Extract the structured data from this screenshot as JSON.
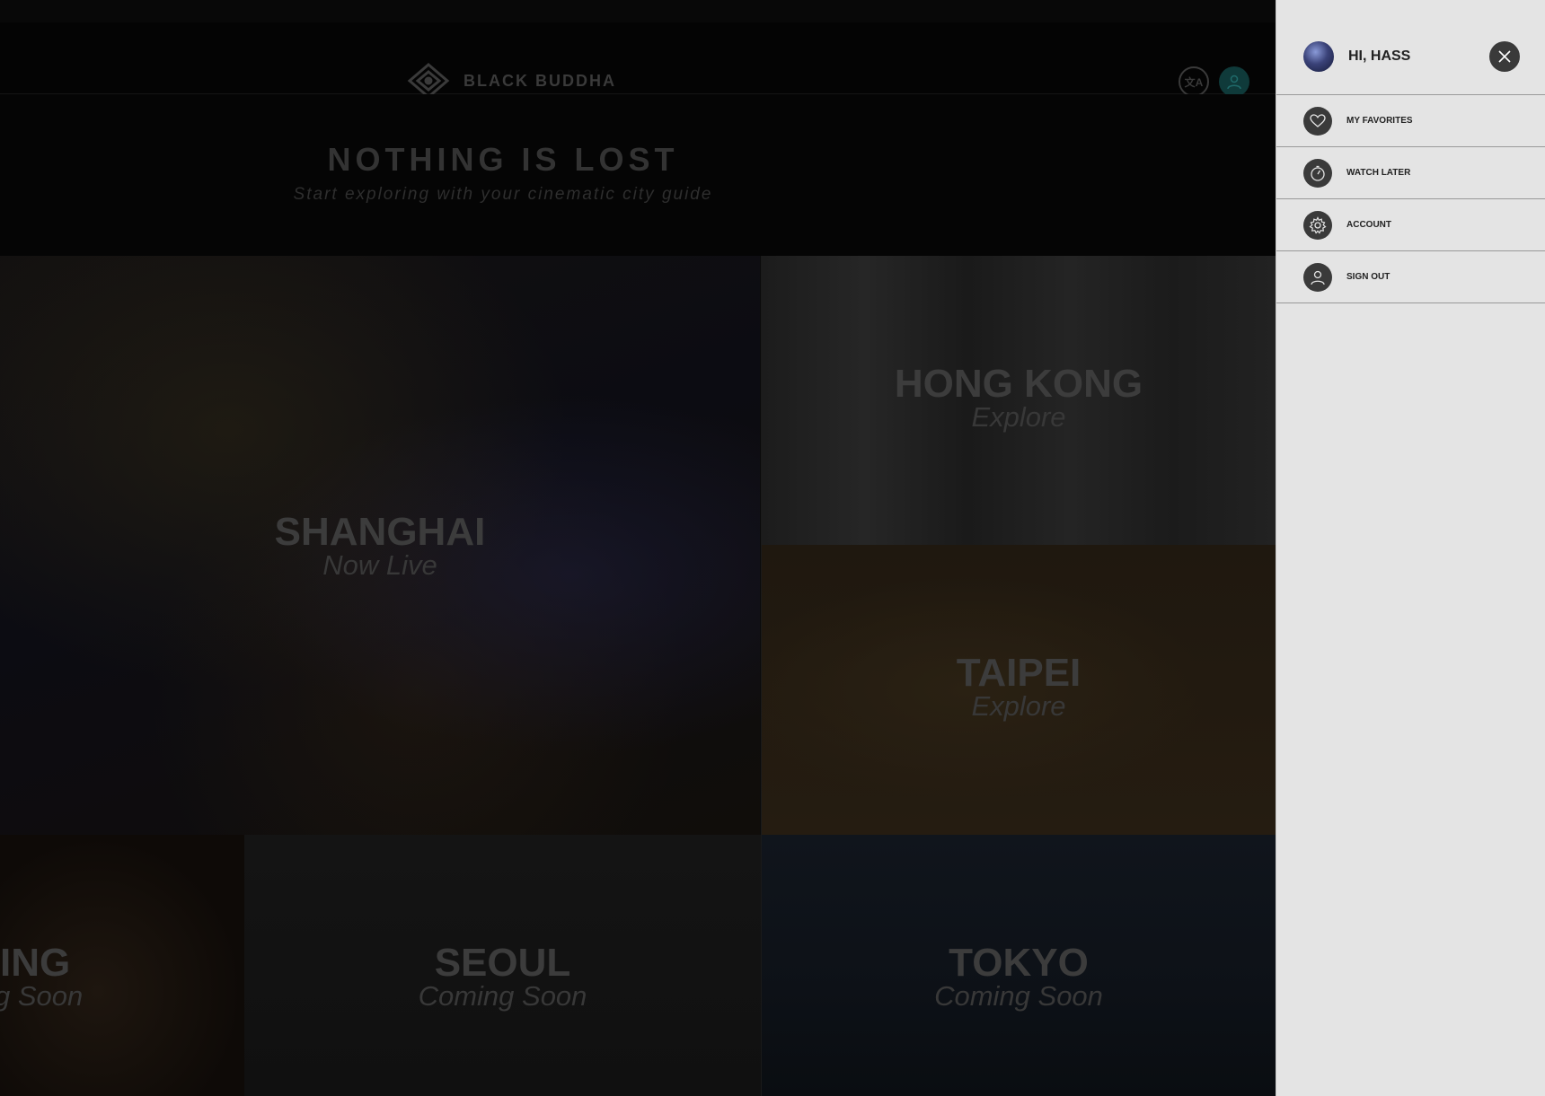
{
  "header": {
    "logo_text": "BLACK BUDDHA",
    "language_button": "文A",
    "user_button_icon": "user-icon"
  },
  "hero": {
    "title": "NOTHING IS LOST",
    "subtitle": "Start exploring with your cinematic city guide"
  },
  "cities": [
    {
      "name": "SHANGHAI",
      "status": "Now Live"
    },
    {
      "name": "HONG KONG",
      "status": "Explore"
    },
    {
      "name": "TAIPEI",
      "status": "Explore"
    },
    {
      "name": "ING",
      "status": "g Soon"
    },
    {
      "name": "SEOUL",
      "status": "Coming Soon"
    },
    {
      "name": "TOKYO",
      "status": "Coming Soon"
    }
  ],
  "drawer": {
    "greeting": "HI, HASS",
    "close_icon": "close-icon",
    "menu": [
      {
        "label": "MY FAVORITES",
        "icon": "heart-icon"
      },
      {
        "label": "WATCH LATER",
        "icon": "stopwatch-icon"
      },
      {
        "label": "ACCOUNT",
        "icon": "gear-icon"
      },
      {
        "label": "SIGN OUT",
        "icon": "user-icon"
      }
    ]
  },
  "colors": {
    "drawer_background": "#e4e4e4",
    "page_dim": "#0b0b0b",
    "accent_teal": "#0f3a3a",
    "icon_dark": "#3a3a3a"
  }
}
